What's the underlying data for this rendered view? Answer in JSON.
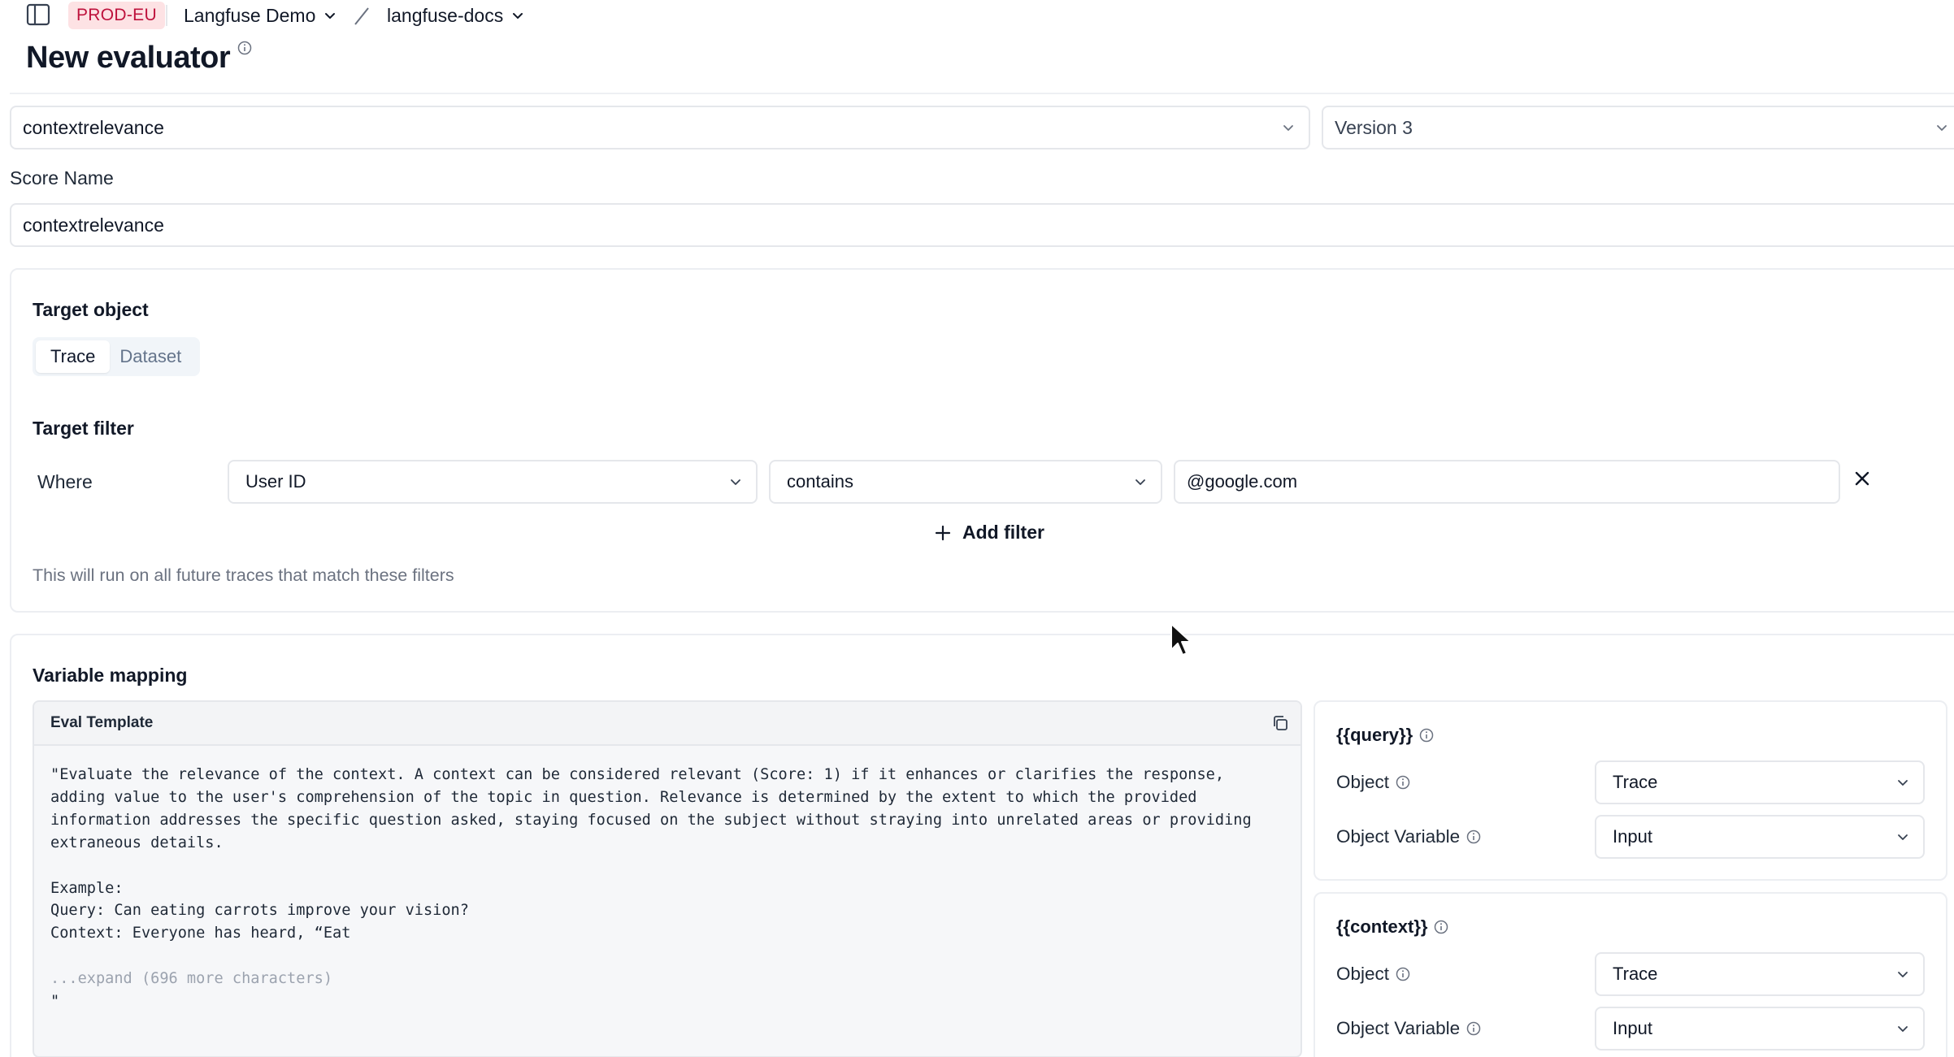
{
  "header": {
    "environment": "PROD-EU",
    "organization": "Langfuse Demo",
    "project": "langfuse-docs"
  },
  "page": {
    "title": "New evaluator"
  },
  "template_select": {
    "value": "contextrelevance"
  },
  "version_select": {
    "value": "Version 3"
  },
  "score_name": {
    "label": "Score Name",
    "value": "contextrelevance"
  },
  "target_object": {
    "label": "Target object",
    "tabs": [
      "Trace",
      "Dataset"
    ],
    "active_tab": "Trace"
  },
  "target_filter": {
    "label": "Target filter",
    "where_label": "Where",
    "column": "User ID",
    "operator": "contains",
    "value": "@google.com",
    "add_filter_label": "Add filter",
    "hint": "This will run on all future traces that match these filters"
  },
  "variable_mapping": {
    "label": "Variable mapping",
    "template_label": "Eval Template",
    "template_lines": [
      "\"Evaluate the relevance of the context. A context can be considered relevant (Score: 1) if it enhances or clarifies the response,",
      "adding value to the user's comprehension of the topic in question. Relevance is determined by the extent to which the provided",
      "information addresses the specific question asked, staying focused on the subject without straying into unrelated areas or providing",
      "extraneous details.",
      "",
      "Example:",
      "Query: Can eating carrots improve your vision?",
      "Context: Everyone has heard, “Eat"
    ],
    "expand_label": "...expand (696 more characters)",
    "closing_quote": "\"",
    "variables": [
      {
        "name": "{{query}}",
        "object_label": "Object",
        "object_value": "Trace",
        "variable_label": "Object Variable",
        "variable_value": "Input"
      },
      {
        "name": "{{context}}",
        "object_label": "Object",
        "object_value": "Trace",
        "variable_label": "Object Variable",
        "variable_value": "Input"
      }
    ]
  },
  "colors": {
    "env_badge_bg": "#fde2e4",
    "env_badge_text": "#be123c",
    "border": "#e5e7eb",
    "muted_text": "#6b7280"
  }
}
